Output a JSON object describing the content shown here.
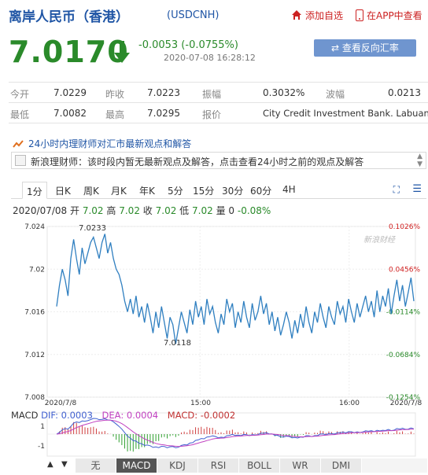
{
  "header": {
    "title": "离岸人民币（香港）",
    "code": "(USDCNH)",
    "add_fav": "添加自选",
    "view_app": "在APP中查看"
  },
  "quote": {
    "price": "7.0170",
    "change": "-0.0053 (-0.0755%)",
    "timestamp": "2020-07-08 16:28:12",
    "reverse_btn": "查看反向汇率",
    "color_down": "#2a8a2a"
  },
  "table": {
    "open_label": "今开",
    "open": "7.0229",
    "prev_label": "昨收",
    "prev": "7.0223",
    "amp_label": "振幅",
    "amp": "0.3032%",
    "wave_label": "波幅",
    "wave": "0.0213",
    "low_label": "最低",
    "low": "7.0082",
    "high_label": "最高",
    "high": "7.0295",
    "bank_label": "报价",
    "bank": "City Credit Investment Bank. Labuan"
  },
  "expert": {
    "title": "24小时内理财师对汇市最新观点和解答",
    "message": "新浪理财师：该时段内暂无最新观点及解答，点击查看24小时之前的观点及解答"
  },
  "tabs": [
    "1分",
    "日K",
    "周K",
    "月K",
    "年K",
    "5分",
    "15分",
    "30分",
    "60分",
    "4H"
  ],
  "ohlc": {
    "date": "2020/07/08",
    "open_label": "开",
    "open": "7.02",
    "high_label": "高",
    "high": "7.02",
    "close_label": "收",
    "close": "7.02",
    "low_label": "低",
    "low": "7.02",
    "vol_label": "量",
    "vol": "0",
    "pct": "-0.08%"
  },
  "chart_data": {
    "type": "line",
    "y_ticks": [
      "7.024",
      "7.02",
      "7.016",
      "7.012",
      "7.008"
    ],
    "pct_ticks": [
      "0.1026%",
      "0.0456%",
      "-0.0114%",
      "-0.0684%",
      "-0.1254%"
    ],
    "x_ticks": [
      "2020/7/8",
      "15:00",
      "16:00",
      "2020/7/8"
    ],
    "max_label": "7.0233",
    "min_label": "7.0118",
    "watermark": "新浪财经",
    "ylim": [
      7.008,
      7.024
    ],
    "series": [
      {
        "values": [
          7.0165,
          7.0185,
          7.02,
          7.019,
          7.0175,
          7.021,
          7.0228,
          7.021,
          7.0195,
          7.022,
          7.0205,
          7.0215,
          7.0225,
          7.023,
          7.022,
          7.021,
          7.0225,
          7.0233,
          7.0215,
          7.0225,
          7.021,
          7.02,
          7.0195,
          7.0185,
          7.017,
          7.016,
          7.0172,
          7.0158,
          7.0175,
          7.0155,
          7.0165,
          7.015,
          7.0168,
          7.0155,
          7.014,
          7.016,
          7.0145,
          7.0165,
          7.015,
          7.0135,
          7.0155,
          7.0148,
          7.013,
          7.0145,
          7.016,
          7.015,
          7.014,
          7.0162,
          7.0148,
          7.017,
          7.0155,
          7.0165,
          7.0148,
          7.0172,
          7.0158,
          7.0165,
          7.015,
          7.014,
          7.0158,
          7.0148,
          7.0172,
          7.016,
          7.0168,
          7.0145,
          7.016,
          7.015,
          7.017,
          7.0155,
          7.0145,
          7.0168,
          7.0152,
          7.016,
          7.0175,
          7.0158,
          7.0168,
          7.0148,
          7.016,
          7.0142,
          7.0155,
          7.0138,
          7.0148,
          7.016,
          7.015,
          7.0135,
          7.0152,
          7.014,
          7.0158,
          7.0145,
          7.0165,
          7.015,
          7.014,
          7.016,
          7.015,
          7.0168,
          7.0155,
          7.0145,
          7.0165,
          7.0155,
          7.0148,
          7.017,
          7.0158,
          7.0165,
          7.015,
          7.0172,
          7.016,
          7.015,
          7.0168,
          7.0155,
          7.0165,
          7.0175,
          7.016,
          7.017,
          7.0155,
          7.018,
          7.016,
          7.0175,
          7.0165,
          7.0182,
          7.0158,
          7.0175,
          7.019,
          7.017,
          7.0185,
          7.0165,
          7.0178,
          7.0192,
          7.017
        ]
      }
    ]
  },
  "macd": {
    "label": "MACD",
    "dif_label": "DIF:",
    "dif": "0.0003",
    "dea_label": "DEA:",
    "dea": "0.0004",
    "macd_label": "MACD:",
    "macd_val": "-0.0002",
    "y_ticks": [
      "1",
      "-1"
    ]
  },
  "indicators": [
    "无",
    "MACD",
    "KDJ",
    "RSI",
    "BOLL",
    "WR",
    "DMI"
  ],
  "nav": {
    "prev": "▲",
    "next": "▼"
  }
}
